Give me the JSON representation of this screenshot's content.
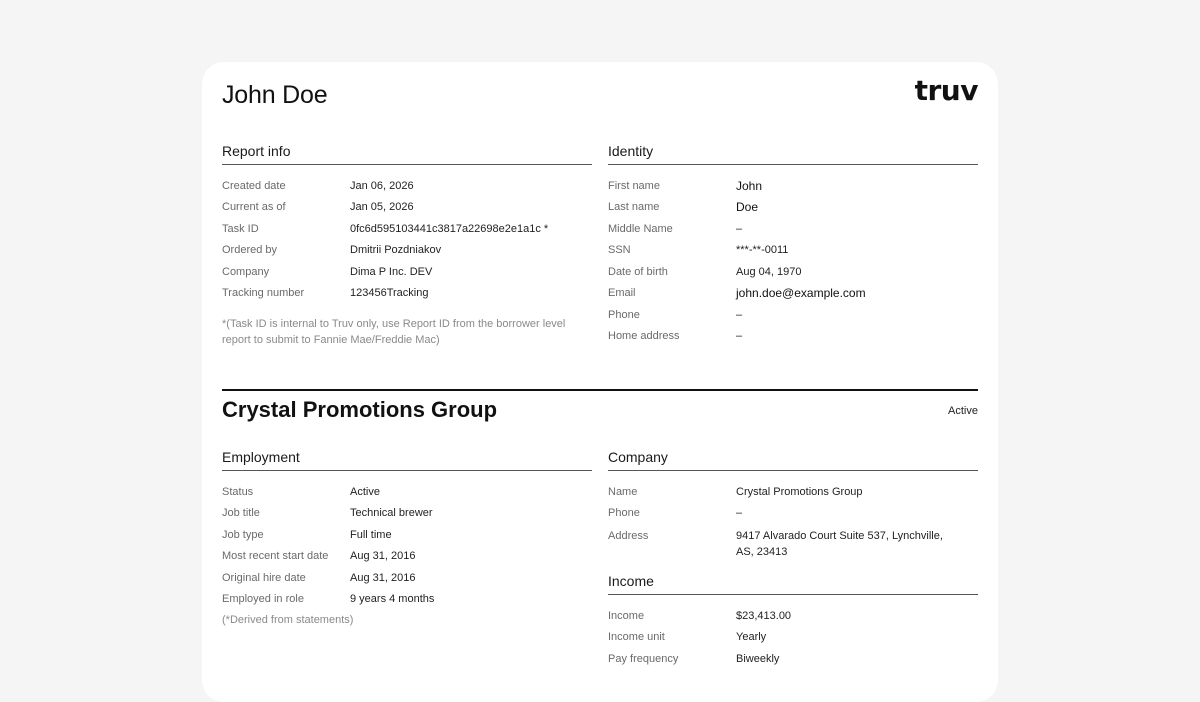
{
  "person": {
    "name": "John Doe"
  },
  "brand": {
    "logo_text": "truv"
  },
  "report_info": {
    "title": "Report info",
    "rows": [
      {
        "label": "Created date",
        "value": "Jan 06, 2026"
      },
      {
        "label": "Current as of",
        "value": "Jan 05, 2026"
      },
      {
        "label": "Task ID",
        "value": "0fc6d595103441c3817a22698e2e1a1c *"
      },
      {
        "label": "Ordered by",
        "value": "Dmitrii Pozdniakov"
      },
      {
        "label": "Company",
        "value": "Dima P Inc. DEV"
      },
      {
        "label": "Tracking number",
        "value": "123456Tracking"
      }
    ],
    "note": "*(Task ID is internal to Truv only, use Report ID from the borrower level report to submit to Fannie Mae/Freddie Mac)"
  },
  "identity": {
    "title": "Identity",
    "rows": [
      {
        "label": "First name",
        "value": "John"
      },
      {
        "label": "Last name",
        "value": "Doe"
      },
      {
        "label": "Middle Name",
        "value": "–"
      },
      {
        "label": "SSN",
        "value": "***-**-0011"
      },
      {
        "label": "Date of birth",
        "value": "Aug 04, 1970"
      },
      {
        "label": "Email",
        "value": "john.doe@example.com"
      },
      {
        "label": "Phone",
        "value": "–"
      },
      {
        "label": "Home address",
        "value": "–"
      }
    ]
  },
  "employer": {
    "name": "Crystal Promotions Group",
    "status": "Active"
  },
  "employment": {
    "title": "Employment",
    "rows": [
      {
        "label": "Status",
        "value": "Active"
      },
      {
        "label": "Job title",
        "value": "Technical brewer"
      },
      {
        "label": "Job type",
        "value": "Full time"
      },
      {
        "label": "Most recent start date",
        "value": "Aug 31, 2016"
      },
      {
        "label": "Original hire date",
        "value": "Aug 31, 2016"
      },
      {
        "label": "Employed in role",
        "value": "9 years 4 months"
      }
    ],
    "note": "(*Derived from statements)"
  },
  "company": {
    "title": "Company",
    "rows": [
      {
        "label": "Name",
        "value": "Crystal Promotions Group"
      },
      {
        "label": "Phone",
        "value": "–"
      },
      {
        "label": "Address",
        "value": "9417 Alvarado Court Suite 537, Lynchville, AS, 23413"
      }
    ]
  },
  "income": {
    "title": "Income",
    "rows": [
      {
        "label": "Income",
        "value": "$23,413.00"
      },
      {
        "label": "Income unit",
        "value": "Yearly"
      },
      {
        "label": "Pay frequency",
        "value": "Biweekly"
      }
    ]
  }
}
